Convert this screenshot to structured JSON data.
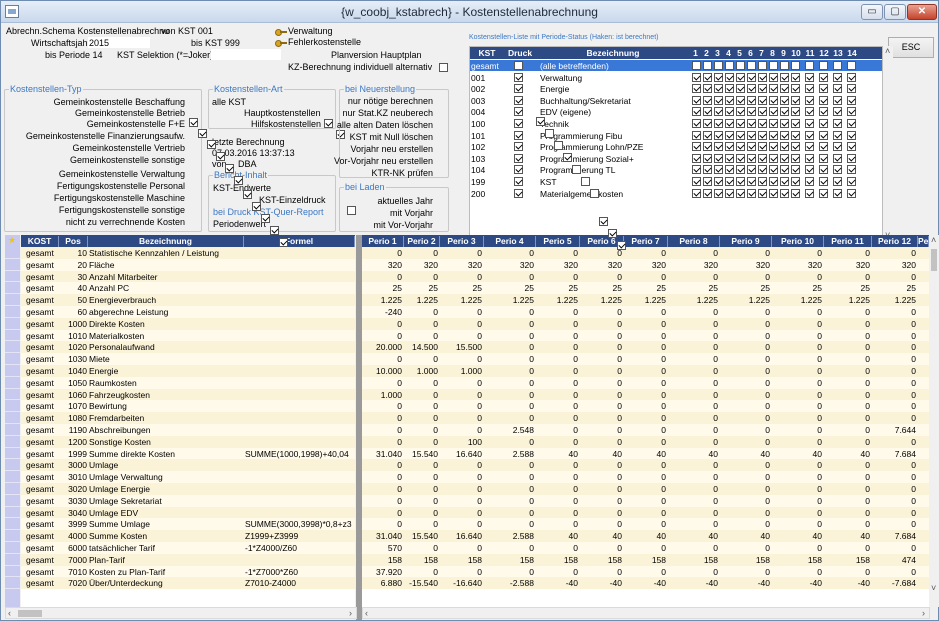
{
  "window": {
    "title": "{w_coobj_kstabrech} - Kostenstellenabrechnung",
    "min": "▭",
    "max": "▢",
    "close": "✕"
  },
  "header": {
    "schema_label": "Abrechn.Schema Kostenstellenabrechnu",
    "wj_label": "Wirtschaftsjahr",
    "wj_value": "2015",
    "bis_periode": "bis Periode 14",
    "selektion": "KST Selektion (*=Joker)",
    "von_kst": "von KST 001",
    "bis_kst": "bis KST 999",
    "verwaltung": "Verwaltung",
    "fehler": "Fehlerkostenstelle",
    "planversion": "Planversion Hauptplan",
    "kz_berechnung": "KZ-Berechnung individuell alternativ"
  },
  "kst_typ": {
    "title": "Kostenstellen-Typ",
    "items": [
      {
        "label": "Gemeinkostenstelle Beschaffung",
        "checked": true
      },
      {
        "label": "Gemeinkostenstelle Betrieb",
        "checked": true
      },
      {
        "label": "Gemeinkostenstelle F+E",
        "checked": true
      },
      {
        "label": "Gemeinkostenstelle Finanzierungsaufw.",
        "checked": true
      },
      {
        "label": "Gemeinkostenstelle Vertrieb",
        "checked": true
      },
      {
        "label": "Gemeinkostenstelle sonstige",
        "checked": true
      },
      {
        "label": "Gemeinkostenstelle Verwaltung",
        "checked": true
      },
      {
        "label": "Fertigungskostenstelle Personal",
        "checked": true
      },
      {
        "label": "Fertigungskostenstelle Maschine",
        "checked": true
      },
      {
        "label": "Fertigungskostenstelle sonstige",
        "checked": true
      },
      {
        "label": "nicht zu verrechnende Kosten",
        "checked": true
      }
    ]
  },
  "kst_art": {
    "title": "Kostenstellen-Art",
    "value": "alle KST",
    "haupt": "Hauptkostenstellen",
    "hilfs": "Hilfskostenstellen"
  },
  "letzte": {
    "label": "letzte Berechnung",
    "date": "07.03.2016 13:37:13",
    "von": "von",
    "user": "DBA"
  },
  "bericht": {
    "title": "Bericht-Inhalt",
    "value": "KST-Endwerte",
    "einzeldruck": "KST-Einzeldruck",
    "quer_title": "bei Druck KST-Quer-Report",
    "quer_value": "Periodenwert"
  },
  "neu": {
    "title": "bei Neuerstellung",
    "items": [
      {
        "label": "nur nötige berechnen",
        "checked": true
      },
      {
        "label": "nur Stat.KZ neuberech",
        "checked": false
      },
      {
        "label": "alle alten Daten löschen",
        "checked": false
      },
      {
        "label": "KST mit Null löschen",
        "checked": true
      },
      {
        "label": "Vorjahr neu erstellen",
        "checked": false
      },
      {
        "label": "Vor-Vorjahr neu erstellen",
        "checked": false
      },
      {
        "label": "KTR-NK prüfen",
        "checked": false
      }
    ]
  },
  "laden": {
    "title": "bei Laden",
    "items": [
      {
        "label": "aktuelles Jahr",
        "checked": true
      },
      {
        "label": "mit Vorjahr",
        "checked": true
      },
      {
        "label": "mit Vor-Vorjahr",
        "checked": true
      }
    ]
  },
  "esc": "ESC",
  "kstlist": {
    "caption": "Kostenstellen-Liste mit Periode-Status (Haken: ist berechnet)",
    "headers": {
      "kst": "KST",
      "druck": "Druck",
      "bez": "Bezeichnung",
      "periods": [
        "1",
        "2",
        "3",
        "4",
        "5",
        "6",
        "7",
        "8",
        "9",
        "10",
        "11",
        "12",
        "13",
        "14"
      ]
    },
    "rows": [
      {
        "kst": "gesamt",
        "bez": "(alle betreffenden)",
        "druck": false,
        "sel": true
      },
      {
        "kst": "001",
        "bez": "Verwaltung",
        "druck": true
      },
      {
        "kst": "002",
        "bez": "Energie",
        "druck": true
      },
      {
        "kst": "003",
        "bez": "Buchhaltung/Sekretariat",
        "druck": true
      },
      {
        "kst": "004",
        "bez": "EDV (eigene)",
        "druck": true
      },
      {
        "kst": "100",
        "bez": "Technik",
        "druck": true
      },
      {
        "kst": "101",
        "bez": "Programmierung Fibu",
        "druck": true
      },
      {
        "kst": "102",
        "bez": "Programmierung Lohn/PZE",
        "druck": true
      },
      {
        "kst": "103",
        "bez": "Programmierung Sozial+",
        "druck": true
      },
      {
        "kst": "104",
        "bez": "Programmierung TL",
        "druck": true
      },
      {
        "kst": "199",
        "bez": "KST",
        "druck": true
      },
      {
        "kst": "200",
        "bez": "Materialgemeinkosten",
        "druck": true
      }
    ]
  },
  "grid": {
    "headers": {
      "kost": "KOST",
      "pos": "Pos",
      "bez": "Bezeichnung",
      "formel": "Formel",
      "star": "★",
      "periods": [
        "Perio 1",
        "Perio 2",
        "Perio 3",
        "Perio 4",
        "Perio 5",
        "Perio 6",
        "Perio 7",
        "Perio 8",
        "Perio 9",
        "Perio 10",
        "Perio 11",
        "Perio 12",
        "Pe"
      ]
    },
    "rows": [
      {
        "kost": "gesamt",
        "pos": "10",
        "bez": "Statistische Kennzahlen / Leistung",
        "formel": "",
        "v": [
          "0",
          "0",
          "0",
          "0",
          "0",
          "0",
          "0",
          "0",
          "0",
          "0",
          "0",
          "0"
        ]
      },
      {
        "kost": "gesamt",
        "pos": "20",
        "bez": "Fläche",
        "formel": "",
        "v": [
          "320",
          "320",
          "320",
          "320",
          "320",
          "320",
          "320",
          "320",
          "320",
          "320",
          "320",
          "320"
        ]
      },
      {
        "kost": "gesamt",
        "pos": "30",
        "bez": "Anzahl Mitarbeiter",
        "formel": "",
        "v": [
          "0",
          "0",
          "0",
          "0",
          "0",
          "0",
          "0",
          "0",
          "0",
          "0",
          "0",
          "0"
        ]
      },
      {
        "kost": "gesamt",
        "pos": "40",
        "bez": "Anzahl PC",
        "formel": "",
        "v": [
          "25",
          "25",
          "25",
          "25",
          "25",
          "25",
          "25",
          "25",
          "25",
          "25",
          "25",
          "25"
        ]
      },
      {
        "kost": "gesamt",
        "pos": "50",
        "bez": "Energieverbrauch",
        "formel": "",
        "v": [
          "1.225",
          "1.225",
          "1.225",
          "1.225",
          "1.225",
          "1.225",
          "1.225",
          "1.225",
          "1.225",
          "1.225",
          "1.225",
          "1.225"
        ]
      },
      {
        "kost": "gesamt",
        "pos": "60",
        "bez": "abgerechne Leistung",
        "formel": "",
        "v": [
          "-240",
          "0",
          "0",
          "0",
          "0",
          "0",
          "0",
          "0",
          "0",
          "0",
          "0",
          "0"
        ]
      },
      {
        "kost": "gesamt",
        "pos": "1000",
        "bez": "Direkte Kosten",
        "formel": "",
        "v": [
          "0",
          "0",
          "0",
          "0",
          "0",
          "0",
          "0",
          "0",
          "0",
          "0",
          "0",
          "0"
        ]
      },
      {
        "kost": "gesamt",
        "pos": "1010",
        "bez": "Materialkosten",
        "formel": "",
        "v": [
          "0",
          "0",
          "0",
          "0",
          "0",
          "0",
          "0",
          "0",
          "0",
          "0",
          "0",
          "0"
        ]
      },
      {
        "kost": "gesamt",
        "pos": "1020",
        "bez": "Personalaufwand",
        "formel": "",
        "v": [
          "20.000",
          "14.500",
          "15.500",
          "0",
          "0",
          "0",
          "0",
          "0",
          "0",
          "0",
          "0",
          "0"
        ]
      },
      {
        "kost": "gesamt",
        "pos": "1030",
        "bez": "Miete",
        "formel": "",
        "v": [
          "0",
          "0",
          "0",
          "0",
          "0",
          "0",
          "0",
          "0",
          "0",
          "0",
          "0",
          "0"
        ]
      },
      {
        "kost": "gesamt",
        "pos": "1040",
        "bez": "Energie",
        "formel": "",
        "v": [
          "10.000",
          "1.000",
          "1.000",
          "0",
          "0",
          "0",
          "0",
          "0",
          "0",
          "0",
          "0",
          "0"
        ]
      },
      {
        "kost": "gesamt",
        "pos": "1050",
        "bez": "Raumkosten",
        "formel": "",
        "v": [
          "0",
          "0",
          "0",
          "0",
          "0",
          "0",
          "0",
          "0",
          "0",
          "0",
          "0",
          "0"
        ]
      },
      {
        "kost": "gesamt",
        "pos": "1060",
        "bez": "Fahrzeugkosten",
        "formel": "",
        "v": [
          "1.000",
          "0",
          "0",
          "0",
          "0",
          "0",
          "0",
          "0",
          "0",
          "0",
          "0",
          "0"
        ]
      },
      {
        "kost": "gesamt",
        "pos": "1070",
        "bez": "Bewirtung",
        "formel": "",
        "v": [
          "0",
          "0",
          "0",
          "0",
          "0",
          "0",
          "0",
          "0",
          "0",
          "0",
          "0",
          "0"
        ]
      },
      {
        "kost": "gesamt",
        "pos": "1080",
        "bez": "Fremdarbeiten",
        "formel": "",
        "v": [
          "0",
          "0",
          "0",
          "0",
          "0",
          "0",
          "0",
          "0",
          "0",
          "0",
          "0",
          "0"
        ]
      },
      {
        "kost": "gesamt",
        "pos": "1190",
        "bez": "Abschreibungen",
        "formel": "",
        "v": [
          "0",
          "0",
          "0",
          "2.548",
          "0",
          "0",
          "0",
          "0",
          "0",
          "0",
          "0",
          "7.644"
        ]
      },
      {
        "kost": "gesamt",
        "pos": "1200",
        "bez": "Sonstige Kosten",
        "formel": "",
        "v": [
          "0",
          "0",
          "100",
          "0",
          "0",
          "0",
          "0",
          "0",
          "0",
          "0",
          "0",
          "0"
        ]
      },
      {
        "kost": "gesamt",
        "pos": "1999",
        "bez": "Summe direkte Kosten",
        "formel": "SUMME(1000,1998)+40,04",
        "v": [
          "31.040",
          "15.540",
          "16.640",
          "2.588",
          "40",
          "40",
          "40",
          "40",
          "40",
          "40",
          "40",
          "7.684"
        ]
      },
      {
        "kost": "gesamt",
        "pos": "3000",
        "bez": "Umlage",
        "formel": "",
        "v": [
          "0",
          "0",
          "0",
          "0",
          "0",
          "0",
          "0",
          "0",
          "0",
          "0",
          "0",
          "0"
        ]
      },
      {
        "kost": "gesamt",
        "pos": "3010",
        "bez": "Umlage Verwaltung",
        "formel": "",
        "v": [
          "0",
          "0",
          "0",
          "0",
          "0",
          "0",
          "0",
          "0",
          "0",
          "0",
          "0",
          "0"
        ]
      },
      {
        "kost": "gesamt",
        "pos": "3020",
        "bez": "Umlage Energie",
        "formel": "",
        "v": [
          "0",
          "0",
          "0",
          "0",
          "0",
          "0",
          "0",
          "0",
          "0",
          "0",
          "0",
          "0"
        ]
      },
      {
        "kost": "gesamt",
        "pos": "3030",
        "bez": "Umlage Sekretariat",
        "formel": "",
        "v": [
          "0",
          "0",
          "0",
          "0",
          "0",
          "0",
          "0",
          "0",
          "0",
          "0",
          "0",
          "0"
        ]
      },
      {
        "kost": "gesamt",
        "pos": "3040",
        "bez": "Umlage EDV",
        "formel": "",
        "v": [
          "0",
          "0",
          "0",
          "0",
          "0",
          "0",
          "0",
          "0",
          "0",
          "0",
          "0",
          "0"
        ]
      },
      {
        "kost": "gesamt",
        "pos": "3999",
        "bez": "Summe Umlage",
        "formel": "SUMME(3000,3998)*0,8+z3",
        "v": [
          "0",
          "0",
          "0",
          "0",
          "0",
          "0",
          "0",
          "0",
          "0",
          "0",
          "0",
          "0"
        ]
      },
      {
        "kost": "gesamt",
        "pos": "4000",
        "bez": "Summe Kosten",
        "formel": "Z1999+Z3999",
        "v": [
          "31.040",
          "15.540",
          "16.640",
          "2.588",
          "40",
          "40",
          "40",
          "40",
          "40",
          "40",
          "40",
          "7.684"
        ]
      },
      {
        "kost": "gesamt",
        "pos": "6000",
        "bez": "tatsächlicher Tarif",
        "formel": "-1*Z4000/Z60",
        "v": [
          "570",
          "0",
          "0",
          "0",
          "0",
          "0",
          "0",
          "0",
          "0",
          "0",
          "0",
          "0"
        ]
      },
      {
        "kost": "gesamt",
        "pos": "7000",
        "bez": "Plan-Tarif",
        "formel": "",
        "v": [
          "158",
          "158",
          "158",
          "158",
          "158",
          "158",
          "158",
          "158",
          "158",
          "158",
          "158",
          "474"
        ]
      },
      {
        "kost": "gesamt",
        "pos": "7010",
        "bez": "Kosten zu Plan-Tarif",
        "formel": "-1*Z7000*Z60",
        "v": [
          "37.920",
          "0",
          "0",
          "0",
          "0",
          "0",
          "0",
          "0",
          "0",
          "0",
          "0",
          "0"
        ]
      },
      {
        "kost": "gesamt",
        "pos": "7020",
        "bez": "Über/Unterdeckung",
        "formel": "Z7010-Z4000",
        "v": [
          "6.880",
          "-15.540",
          "-16.640",
          "-2.588",
          "-40",
          "-40",
          "-40",
          "-40",
          "-40",
          "-40",
          "-40",
          "-7.684"
        ]
      }
    ]
  }
}
